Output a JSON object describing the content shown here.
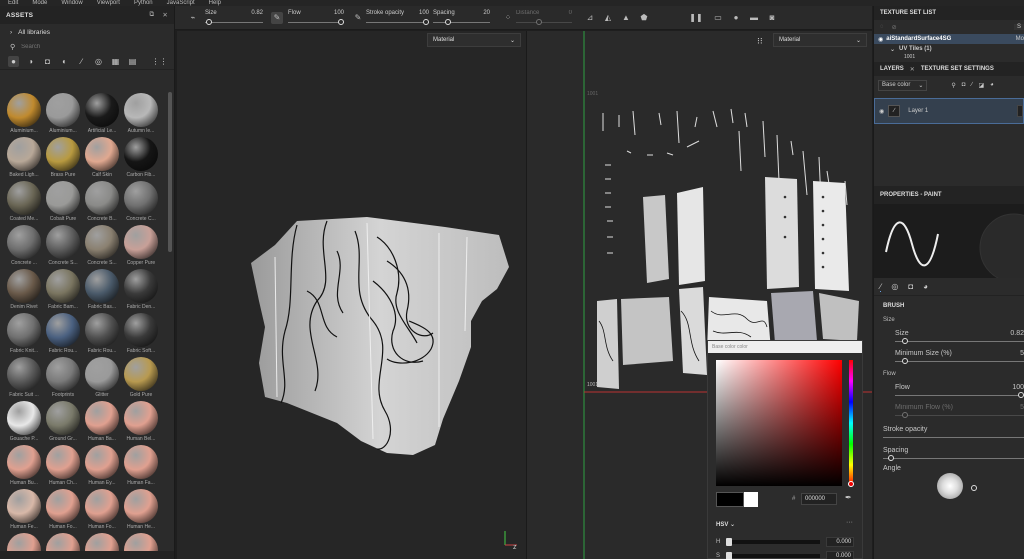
{
  "menu": [
    "Edit",
    "Mode",
    "Window",
    "Viewport",
    "Python",
    "JavaScript",
    "Help"
  ],
  "assets": {
    "title": "ASSETS",
    "all_libraries": "All libraries",
    "search_placeholder": "Search",
    "items": [
      {
        "label": "Aluminium...",
        "color": "#c08a2e"
      },
      {
        "label": "Aluminium...",
        "color": "#9a9a9a"
      },
      {
        "label": "Artificial Le...",
        "color": "#1a1a1a"
      },
      {
        "label": "Autumn le...",
        "color": "#b8b8b8"
      },
      {
        "label": "Baked Ligh...",
        "color": "#b8a898"
      },
      {
        "label": "Brass Pure",
        "color": "#b89a40"
      },
      {
        "label": "Calf Skin",
        "color": "#e0a890"
      },
      {
        "label": "Carbon Fib...",
        "color": "#151515"
      },
      {
        "label": "Coated Me...",
        "color": "#6a6655"
      },
      {
        "label": "Cobalt Pure",
        "color": "#9a9a98"
      },
      {
        "label": "Concrete B...",
        "color": "#8a8a88"
      },
      {
        "label": "Concrete C...",
        "color": "#707070"
      },
      {
        "label": "Concrete ...",
        "color": "#6e6e6e"
      },
      {
        "label": "Concrete S...",
        "color": "#5e5e5e"
      },
      {
        "label": "Concrete S...",
        "color": "#8a8070"
      },
      {
        "label": "Copper Pure",
        "color": "#c8a098"
      },
      {
        "label": "Denim Rivet",
        "color": "#6a5a4a"
      },
      {
        "label": "Fabric Bam...",
        "color": "#7a7560"
      },
      {
        "label": "Fabric Bas...",
        "color": "#4a5a6a"
      },
      {
        "label": "Fabric Den...",
        "color": "#3a3a3a"
      },
      {
        "label": "Fabric Knit...",
        "color": "#707070"
      },
      {
        "label": "Fabric Rou...",
        "color": "#4a6080"
      },
      {
        "label": "Fabric Rou...",
        "color": "#505050"
      },
      {
        "label": "Fabric Soft...",
        "color": "#3a3a3a"
      },
      {
        "label": "Fabric Suit ...",
        "color": "#5a5a5a"
      },
      {
        "label": "Footprints",
        "color": "#7a7a7a"
      },
      {
        "label": "Glitter",
        "color": "#9a9a9a"
      },
      {
        "label": "Gold Pure",
        "color": "#b89a50"
      },
      {
        "label": "Gouache P...",
        "color": "#e8e8e8"
      },
      {
        "label": "Ground Gr...",
        "color": "#7a7a6a"
      },
      {
        "label": "Human Ba...",
        "color": "#e0a090"
      },
      {
        "label": "Human Bel...",
        "color": "#e0a090"
      },
      {
        "label": "Human Bu...",
        "color": "#e0a090"
      },
      {
        "label": "Human Ch...",
        "color": "#e0a090"
      },
      {
        "label": "Human Ey...",
        "color": "#e0a090"
      },
      {
        "label": "Human Fa...",
        "color": "#e0a090"
      },
      {
        "label": "Human Fe...",
        "color": "#d8b8a8"
      },
      {
        "label": "Human Fo...",
        "color": "#e0a090"
      },
      {
        "label": "Human Fo...",
        "color": "#e0a090"
      },
      {
        "label": "Human He...",
        "color": "#e0a090"
      },
      {
        "label": "",
        "color": "#e0a090"
      },
      {
        "label": "",
        "color": "#e0a090"
      },
      {
        "label": "",
        "color": "#e0a090"
      },
      {
        "label": "",
        "color": "#e0a090"
      }
    ]
  },
  "toolbar": {
    "size_label": "Size",
    "size_value": "0.82",
    "flow_label": "Flow",
    "flow_value": "100",
    "stroke_opacity_label": "Stroke opacity",
    "stroke_opacity_value": "100",
    "spacing_label": "Spacing",
    "spacing_value": "20",
    "distance_label": "Distance",
    "distance_value": "0"
  },
  "viewport3d": {
    "channel": "Material"
  },
  "viewport2d": {
    "channel": "Material",
    "tile_label": "1001",
    "tile_label_top": "1001"
  },
  "color_picker": {
    "title": "Base color color",
    "hex": "000000",
    "mode": "HSV",
    "h_label": "H",
    "h_value": "0.000",
    "s_label": "S",
    "s_value": "0.000"
  },
  "texture_set_list": {
    "title": "TEXTURE SET LIST",
    "set_name": "aiStandardSurface4SG",
    "set_suffix": "Mo",
    "uv_tiles": "UV Tiles (1)",
    "uv_tile_value": "1001"
  },
  "layers": {
    "tab_layers": "LAYERS",
    "tab_tss": "TEXTURE SET SETTINGS",
    "channel": "Base color",
    "layer_name": "Layer 1"
  },
  "properties": {
    "title": "PROPERTIES - PAINT",
    "brush": "BRUSH",
    "size_section": "Size",
    "size_label": "Size",
    "size_value": "0.82",
    "min_size_label": "Minimum Size (%)",
    "min_size_value": "5",
    "flow_section": "Flow",
    "flow_label": "Flow",
    "flow_value": "100",
    "min_flow_label": "Minimum Flow (%)",
    "min_flow_value": "5",
    "stroke_opacity_label": "Stroke opacity",
    "spacing_label": "Spacing",
    "angle_label": "Angle"
  }
}
